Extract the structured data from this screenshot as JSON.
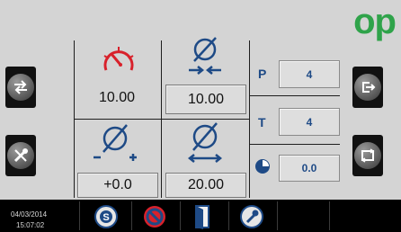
{
  "logo": {
    "text": "op"
  },
  "tiles": {
    "speed_value": "10.00",
    "diameter_in_value": "10.00",
    "offset_value": "+0.0",
    "diameter_out_value": "20.00"
  },
  "params": {
    "p_label": "P",
    "p_value": "4",
    "t_label": "T",
    "t_value": "4",
    "time_value": "0.0"
  },
  "status": {
    "date": "04/03/2014",
    "time": "15:07:02"
  },
  "colors": {
    "accent_red": "#d8212b",
    "accent_blue": "#1e4a86",
    "logo_green": "#2fa34a"
  },
  "icons": {
    "left_top": "swap-arrows-icon",
    "left_bottom": "tools-icon",
    "right_top": "exit-arrow-icon",
    "right_bottom": "cycle-icon",
    "bottom": [
      "settings-s-icon",
      "no-speed-icon",
      "door-icon",
      "wrench-icon"
    ]
  }
}
